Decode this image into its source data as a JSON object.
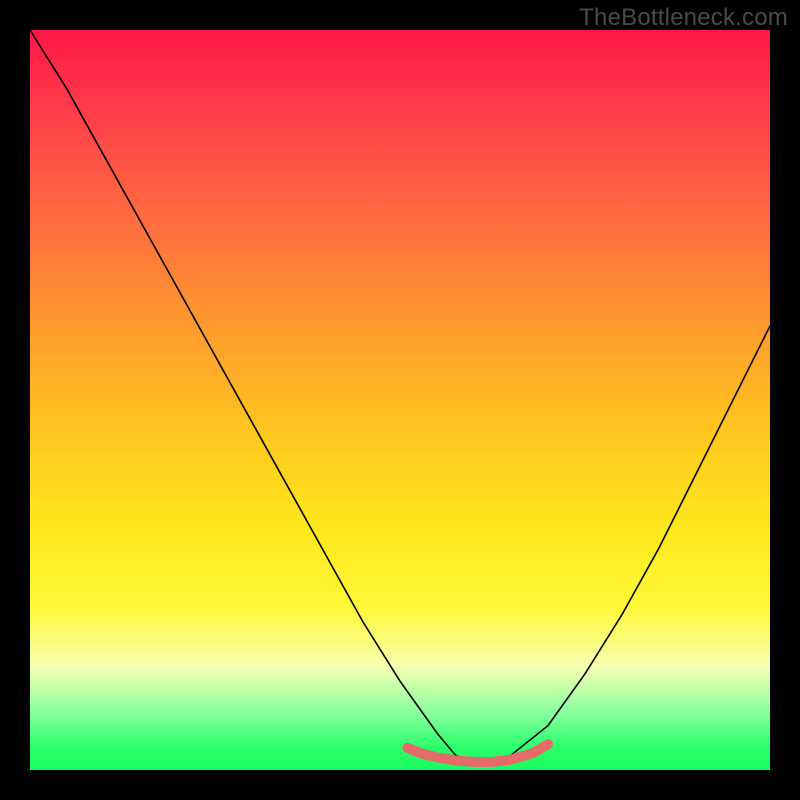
{
  "watermark": "TheBottleneck.com",
  "chart_data": {
    "type": "line",
    "title": "",
    "xlabel": "",
    "ylabel": "",
    "xlim": [
      0,
      100
    ],
    "ylim": [
      0,
      100
    ],
    "grid": false,
    "legend": false,
    "series": [
      {
        "name": "bottleneck-curve",
        "x": [
          0,
          5,
          10,
          15,
          20,
          25,
          30,
          35,
          40,
          45,
          50,
          55,
          57.5,
          60,
          62.5,
          65,
          70,
          75,
          80,
          85,
          90,
          95,
          100
        ],
        "values": [
          100,
          92,
          83,
          74,
          65,
          56,
          47,
          38,
          29,
          20,
          12,
          5,
          2,
          1,
          1,
          2,
          6,
          13,
          21,
          30,
          40,
          50,
          60
        ]
      },
      {
        "name": "optimal-range-highlight",
        "x": [
          51,
          53,
          55,
          57.5,
          60,
          62.5,
          65,
          68,
          70
        ],
        "values": [
          3,
          2.2,
          1.7,
          1.3,
          1.1,
          1.1,
          1.4,
          2.3,
          3.5
        ]
      }
    ],
    "colors": {
      "gradient_top": "#ff1744",
      "gradient_mid": "#ffe81e",
      "gradient_bottom": "#18ff5c",
      "curve": "#000000",
      "highlight": "#e56b6b"
    }
  }
}
